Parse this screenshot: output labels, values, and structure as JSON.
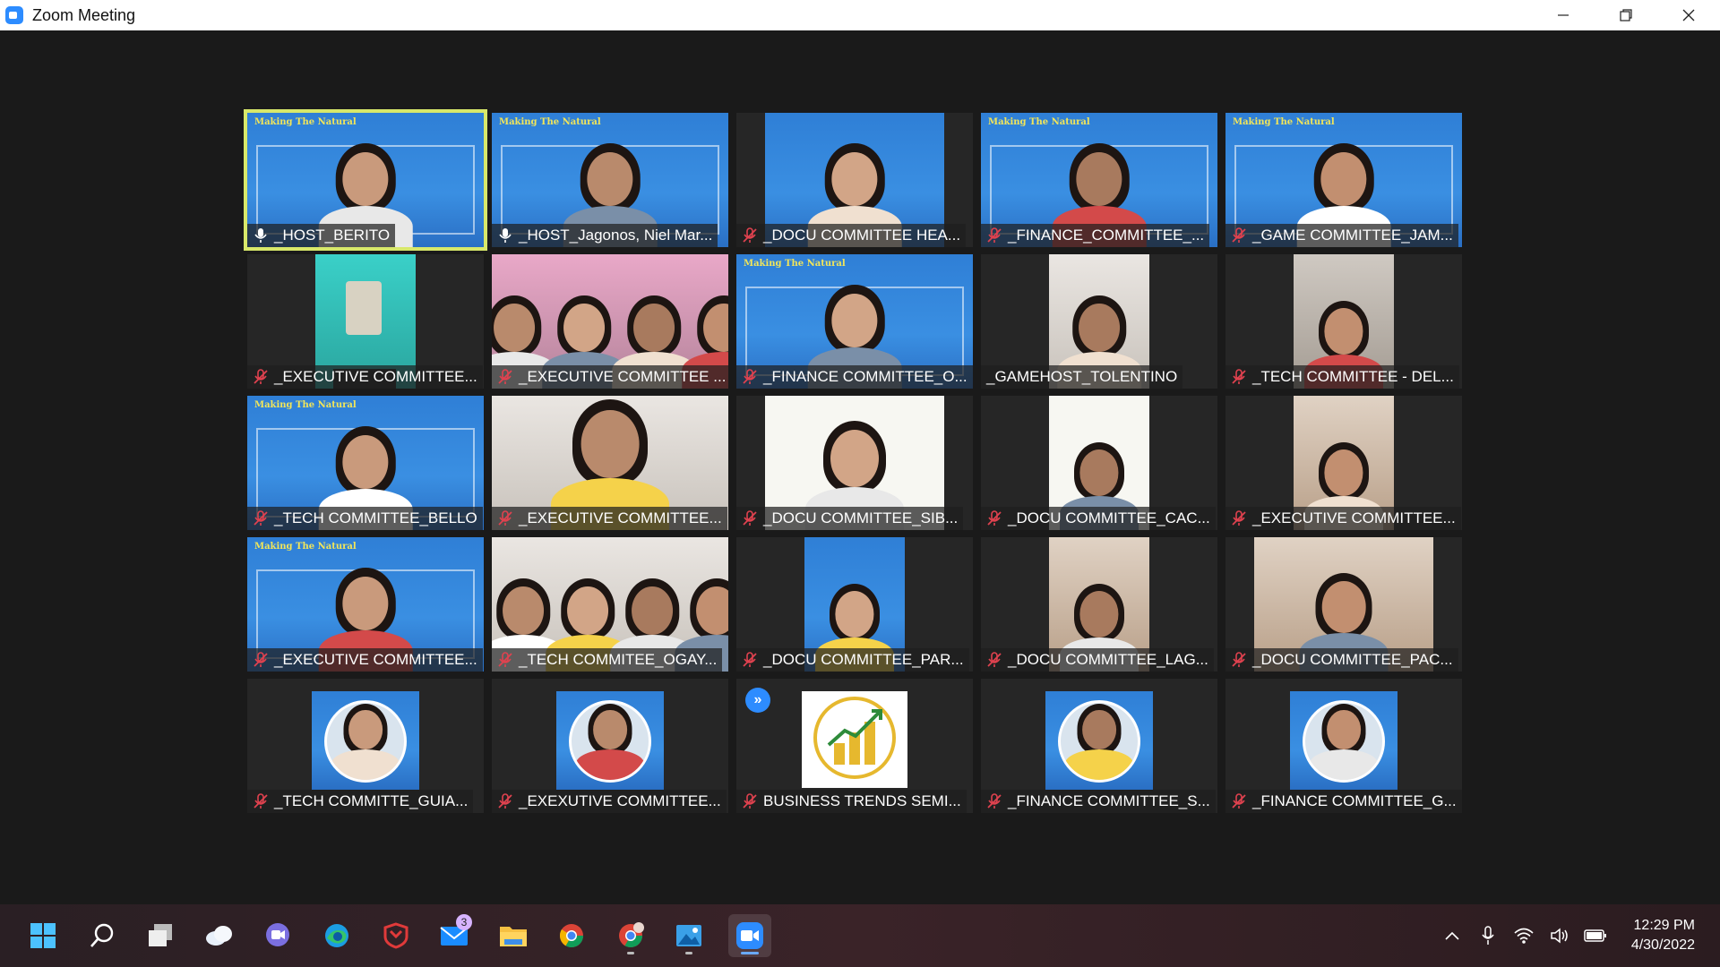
{
  "window": {
    "title": "Zoom Meeting",
    "controls": {
      "minimize": "—",
      "restore": "❐",
      "close": "✕"
    }
  },
  "participants": [
    {
      "name": "_HOST_BERITO",
      "mic": "host",
      "video": "blue-banner",
      "active": true
    },
    {
      "name": "_HOST_Jagonos, Niel Mar...",
      "mic": "host",
      "video": "blue-banner",
      "active": false
    },
    {
      "name": "_DOCU COMMITTEE HEA...",
      "mic": "muted",
      "video": "blue-narrow",
      "active": false
    },
    {
      "name": "_FINANCE_COMMITTEE_...",
      "mic": "muted",
      "video": "blue-banner",
      "active": false
    },
    {
      "name": "_GAME COMMITTEE_JAM...",
      "mic": "muted",
      "video": "blue-banner",
      "active": false
    },
    {
      "name": "_EXECUTIVE COMMITTEE...",
      "mic": "muted",
      "video": "teal-narrow",
      "active": false
    },
    {
      "name": "_EXECUTIVE COMMITTEE ...",
      "mic": "muted",
      "video": "pink-group",
      "active": false
    },
    {
      "name": "_FINANCE COMMITTEE_O...",
      "mic": "muted",
      "video": "blue-banner",
      "active": false
    },
    {
      "name": "_GAMEHOST_TOLENTINO",
      "mic": "none",
      "video": "light-narrow",
      "active": false
    },
    {
      "name": "_TECH COMMITTEE - DEL...",
      "mic": "muted",
      "video": "room-narrow",
      "active": false
    },
    {
      "name": "_TECH COMMITTEE_BELLO",
      "mic": "muted",
      "video": "blue-banner",
      "active": false
    },
    {
      "name": "_EXECUTIVE COMMITTEE...",
      "mic": "muted",
      "video": "light-full",
      "active": false
    },
    {
      "name": "_DOCU COMMITTEE_SIB...",
      "mic": "muted",
      "video": "light-mid",
      "active": false
    },
    {
      "name": "_DOCU COMMITTEE_CAC...",
      "mic": "muted",
      "video": "white-narrow",
      "active": false
    },
    {
      "name": "_EXECUTIVE COMMITTEE...",
      "mic": "muted",
      "video": "warm-narrow",
      "active": false
    },
    {
      "name": "_EXECUTIVE COMMITTEE...",
      "mic": "muted",
      "video": "blue-banner",
      "active": false
    },
    {
      "name": "_TECH COMMITEE_OGAY...",
      "mic": "muted",
      "video": "group-full",
      "active": false
    },
    {
      "name": "_DOCU COMMITTEE_PAR...",
      "mic": "muted",
      "video": "blue-narrow",
      "active": false
    },
    {
      "name": "_DOCU COMMITTEE_LAG...",
      "mic": "muted",
      "video": "warm-narrow",
      "active": false
    },
    {
      "name": "_DOCU COMMITTEE_PAC...",
      "mic": "muted",
      "video": "warm-mid",
      "active": false
    },
    {
      "name": "_TECH COMMITTE_GUIA...",
      "mic": "muted",
      "video": "avatar",
      "active": false
    },
    {
      "name": "_EXEXUTIVE COMMITTEE...",
      "mic": "muted",
      "video": "avatar",
      "active": false
    },
    {
      "name": "BUSINESS TRENDS SEMI...",
      "mic": "muted",
      "video": "logo",
      "active": false
    },
    {
      "name": "_FINANCE COMMITTEE_S...",
      "mic": "muted",
      "video": "avatar",
      "active": false
    },
    {
      "name": "_FINANCE COMMITTEE_G...",
      "mic": "muted",
      "video": "avatar-blue",
      "active": false
    }
  ],
  "banner_text": "Making The Natural",
  "taskbar": {
    "apps": [
      {
        "name": "start-icon"
      },
      {
        "name": "search-icon"
      },
      {
        "name": "task-view-icon"
      },
      {
        "name": "widgets-icon"
      },
      {
        "name": "chat-icon"
      },
      {
        "name": "edge-icon"
      },
      {
        "name": "security-icon"
      },
      {
        "name": "mail-icon",
        "badge": "3"
      },
      {
        "name": "file-explorer-icon"
      },
      {
        "name": "chrome-icon"
      },
      {
        "name": "chrome-profile-icon"
      },
      {
        "name": "photos-icon"
      },
      {
        "name": "zoom-icon"
      }
    ],
    "clock": {
      "time": "12:29 PM",
      "date": "4/30/2022"
    }
  },
  "colors": {
    "active_speaker": "#d8e86a",
    "muted_mic": "#e0424f",
    "zoom_blue": "#2d8cff"
  }
}
